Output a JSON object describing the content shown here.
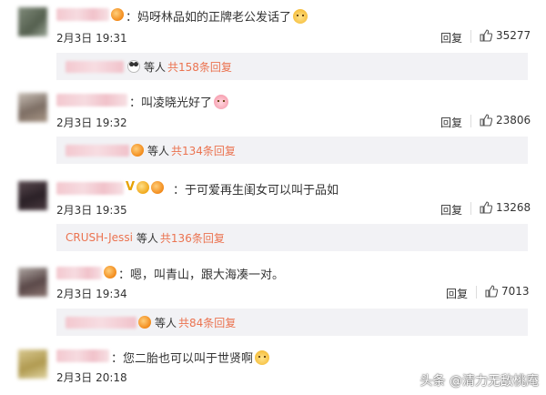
{
  "comments": [
    {
      "text": "：妈呀林品如的正牌老公发话了",
      "time": "2月3日 19:31",
      "reply": "回复",
      "likes": "35277",
      "avatar_color": "#6e7a6a",
      "sub": {
        "others": "等人",
        "count": "共158条回复",
        "emoji": "panda"
      }
    },
    {
      "text": "：叫凌晓光好了",
      "time": "2月3日 19:32",
      "reply": "回复",
      "likes": "23806",
      "avatar_color": "#8a7a70",
      "sub": {
        "others": "等人",
        "count": "共134条回复",
        "emoji": "badge"
      }
    },
    {
      "text": "：于可爱再生闺女可以叫于品如",
      "time": "2月3日 19:35",
      "reply": "回复",
      "likes": "13268",
      "avatar_color": "#3a3036",
      "sub": {
        "name": "CRUSH-Jessi",
        "others": "等人",
        "count": "共136条回复",
        "emoji": "none"
      }
    },
    {
      "text": "：嗯，叫青山，跟大海凑一对。",
      "time": "2月3日 19:34",
      "reply": "回复",
      "likes": "7013",
      "avatar_color": "#5a4a48",
      "sub": {
        "others": "等人",
        "count": "共84条回复",
        "emoji": "badge"
      }
    },
    {
      "text": "：您二胎也可以叫于世贤啊",
      "time": "2月3日 20:18",
      "avatar_color": "#b8a060"
    }
  ],
  "watermark": {
    "text": "头条 @清力无敌桃庵"
  },
  "colors": {
    "link": "#eb7350",
    "sub_bg": "#f2f2f5",
    "text": "#333333"
  },
  "icons": {
    "like": "thumbs-up-icon"
  }
}
